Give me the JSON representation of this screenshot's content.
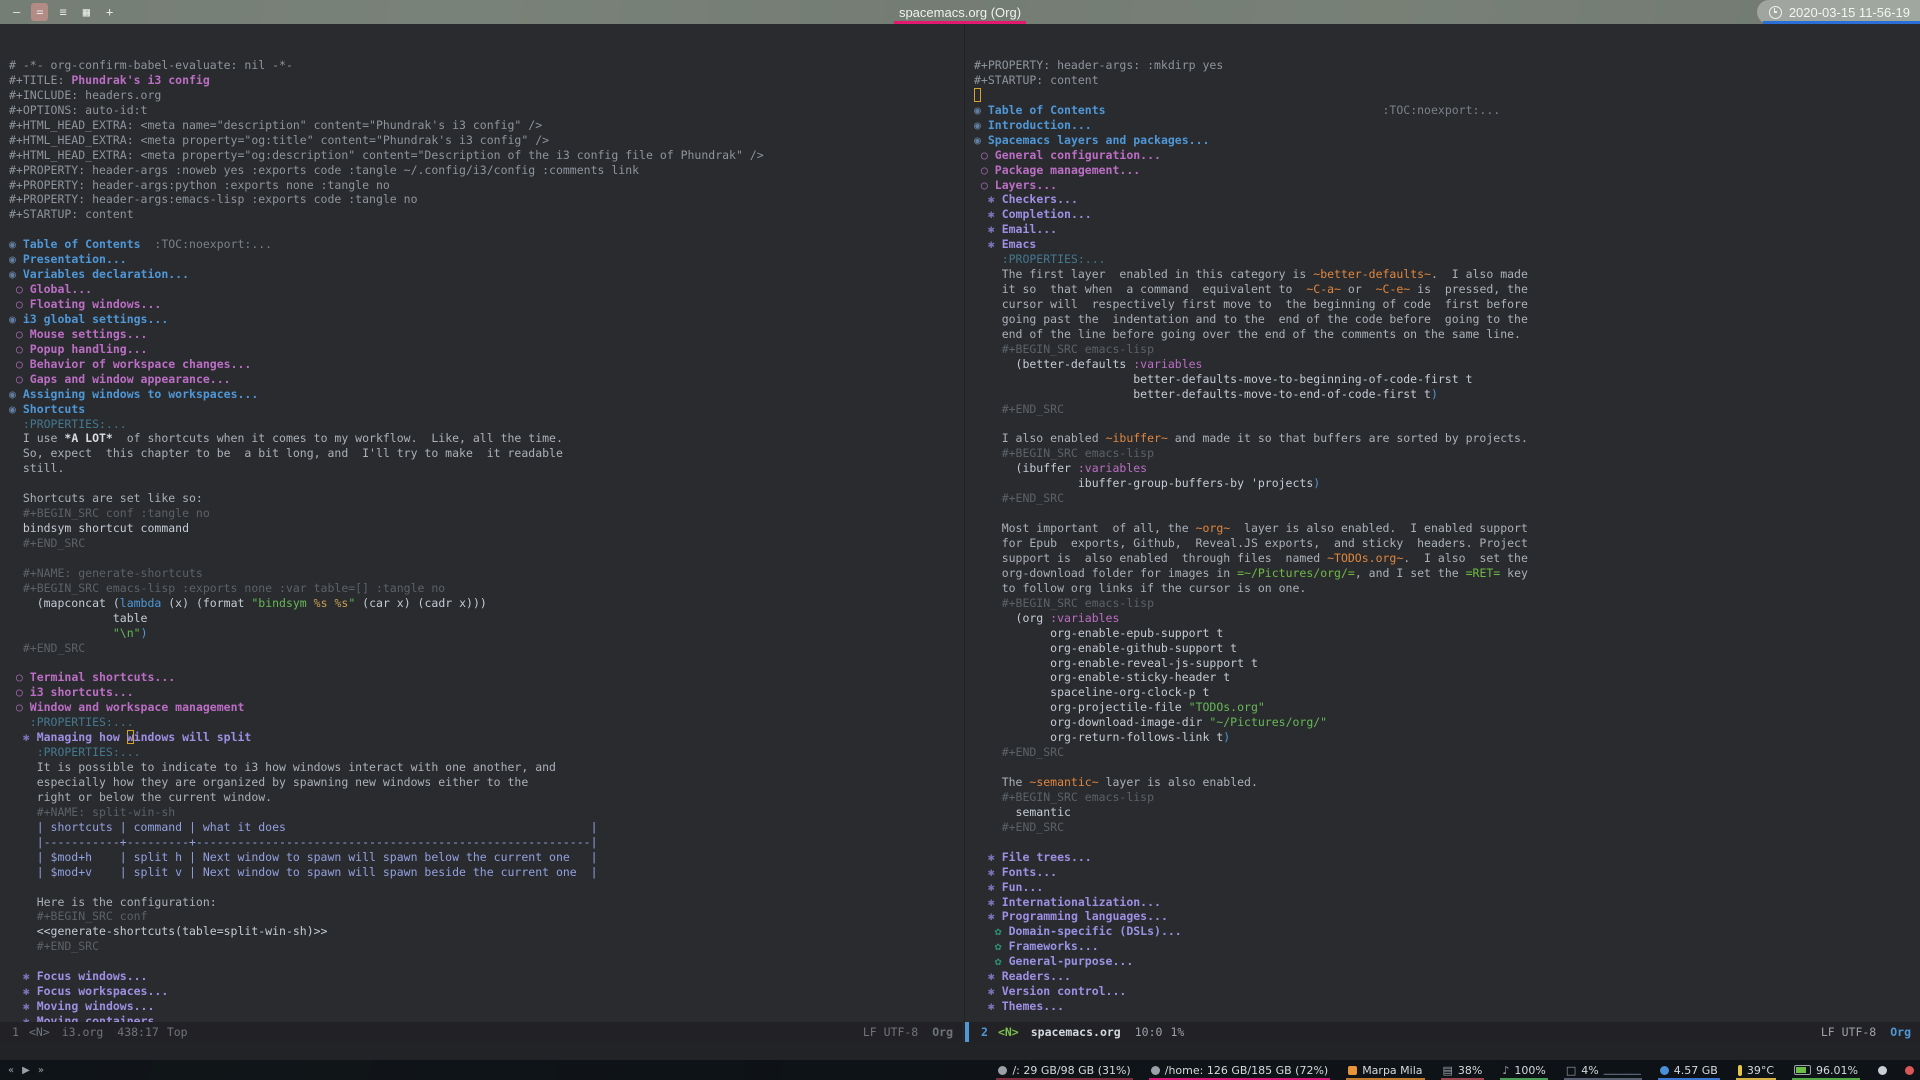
{
  "titlebar": {
    "title": "spacemacs.org (Org)",
    "clock": "2020-03-15 11-56-19",
    "accent_title_underline": "#e2196e",
    "accent_clock_underline": "#2a6fd6",
    "icons": [
      {
        "name": "layout-splith-icon",
        "glyph": "—",
        "active": false
      },
      {
        "name": "layout-stacking-icon",
        "glyph": "=",
        "active": true
      },
      {
        "name": "layout-tabbed-icon",
        "glyph": "≡",
        "active": false
      },
      {
        "name": "layout-grid-icon",
        "glyph": "▦",
        "active": false
      },
      {
        "name": "new-window-icon",
        "glyph": "+",
        "active": false
      }
    ]
  },
  "left_pane": {
    "lines": [
      [
        [
          "cm",
          "# -*- org-confirm-babel-evaluate: nil -*-"
        ]
      ],
      [
        [
          "cm",
          "#+TITLE: "
        ],
        [
          "title",
          "Phundrak's i3 config"
        ]
      ],
      [
        [
          "cm",
          "#+INCLUDE: headers.org"
        ]
      ],
      [
        [
          "cm",
          "#+OPTIONS: auto-id:t"
        ]
      ],
      [
        [
          "cm",
          "#+HTML_HEAD_EXTRA: <meta name=\"description\" content=\"Phundrak's i3 config\" />"
        ]
      ],
      [
        [
          "cm",
          "#+HTML_HEAD_EXTRA: <meta property=\"og:title\" content=\"Phundrak's i3 config\" />"
        ]
      ],
      [
        [
          "cm",
          "#+HTML_HEAD_EXTRA: <meta property=\"og:description\" content=\"Description of the i3 config file of Phundrak\" />"
        ]
      ],
      [
        [
          "cm",
          "#+PROPERTY: header-args :noweb yes :exports code :tangle ~/.config/i3/config :comments link"
        ]
      ],
      [
        [
          "cm",
          "#+PROPERTY: header-args:python :exports none :tangle no"
        ]
      ],
      [
        [
          "cm",
          "#+PROPERTY: header-args:emacs-lisp :exports code :tangle no"
        ]
      ],
      [
        [
          "cm",
          "#+STARTUP: content"
        ]
      ],
      [],
      [
        [
          "b1",
          "◉ "
        ],
        [
          "h1",
          "Table of Contents"
        ],
        [
          "tag",
          "  :TOC:noexport:..."
        ]
      ],
      [
        [
          "b1",
          "◉ "
        ],
        [
          "h1",
          "Presentation..."
        ]
      ],
      [
        [
          "b1",
          "◉ "
        ],
        [
          "h1",
          "Variables declaration..."
        ]
      ],
      [
        [
          "b2",
          " ○ "
        ],
        [
          "h2",
          "Global..."
        ]
      ],
      [
        [
          "b2",
          " ○ "
        ],
        [
          "h2",
          "Floating windows..."
        ]
      ],
      [
        [
          "b1",
          "◉ "
        ],
        [
          "h1",
          "i3 global settings..."
        ]
      ],
      [
        [
          "b2",
          " ○ "
        ],
        [
          "h2",
          "Mouse settings..."
        ]
      ],
      [
        [
          "b2",
          " ○ "
        ],
        [
          "h2",
          "Popup handling..."
        ]
      ],
      [
        [
          "b2",
          " ○ "
        ],
        [
          "h2",
          "Behavior of workspace changes..."
        ]
      ],
      [
        [
          "b2",
          " ○ "
        ],
        [
          "h2",
          "Gaps and window appearance..."
        ]
      ],
      [
        [
          "b1",
          "◉ "
        ],
        [
          "h1",
          "Assigning windows to workspaces..."
        ]
      ],
      [
        [
          "b1",
          "◉ "
        ],
        [
          "h1",
          "Shortcuts"
        ]
      ],
      [
        [
          "drawer",
          "  :PROPERTIES:..."
        ]
      ],
      [
        [
          "body",
          "  I use "
        ],
        [
          "bold",
          "*A LOT*"
        ],
        [
          "body",
          "  of shortcuts when it comes to my workflow.  Like, all the time."
        ]
      ],
      [
        [
          "body",
          "  So, expect  this chapter to be  a bit long, and  I'll try to make  it readable"
        ]
      ],
      [
        [
          "body",
          "  still."
        ]
      ],
      [],
      [
        [
          "body",
          "  Shortcuts are set like so:"
        ]
      ],
      [
        [
          "src",
          "  #+BEGIN_SRC conf :tangle no"
        ]
      ],
      [
        [
          "code",
          "  bindsym shortcut command"
        ]
      ],
      [
        [
          "src",
          "  #+END_SRC"
        ]
      ],
      [],
      [
        [
          "src",
          "  #+NAME: generate-shortcuts"
        ]
      ],
      [
        [
          "src",
          "  #+BEGIN_SRC emacs-lisp :exports none :var table=[] :tangle no"
        ]
      ],
      [
        [
          "code",
          "    (mapconcat ("
        ],
        [
          "kw",
          "lambda"
        ],
        [
          "code",
          " (x) (format "
        ],
        [
          "str",
          "\"bindsym "
        ],
        [
          "fmt",
          "%s"
        ],
        [
          "str",
          " "
        ],
        [
          "fmt",
          "%s"
        ],
        [
          "str",
          "\""
        ],
        [
          "code",
          " (car x) (cadr x)))"
        ]
      ],
      [
        [
          "code",
          "               table"
        ]
      ],
      [
        [
          "code",
          "               "
        ],
        [
          "str",
          "\"\\n\""
        ],
        [
          "pb",
          ")"
        ]
      ],
      [
        [
          "src",
          "  #+END_SRC"
        ]
      ],
      [],
      [
        [
          "b2",
          " ○ "
        ],
        [
          "h2",
          "Terminal shortcuts..."
        ]
      ],
      [
        [
          "b2",
          " ○ "
        ],
        [
          "h2",
          "i3 shortcuts..."
        ]
      ],
      [
        [
          "b2",
          " ○ "
        ],
        [
          "h2",
          "Window and workspace management"
        ]
      ],
      [
        [
          "drawer",
          "   :PROPERTIES:..."
        ]
      ],
      [
        [
          "b3",
          "  ✱ "
        ],
        [
          "h3",
          "Managing how "
        ],
        [
          "h3 cur",
          "w"
        ],
        [
          "h3",
          "indows will split"
        ]
      ],
      [
        [
          "drawer",
          "    :PROPERTIES:..."
        ]
      ],
      [
        [
          "body",
          "    It is possible to indicate to i3 how windows interact with one another, and"
        ]
      ],
      [
        [
          "body",
          "    especially how they are organized by spawning new windows either to the"
        ]
      ],
      [
        [
          "body",
          "    right or below the current window."
        ]
      ],
      [
        [
          "src",
          "    #+NAME: split-win-sh"
        ]
      ],
      [
        [
          "tbl",
          "    | shortcuts | command | what it does                                            |"
        ]
      ],
      [
        [
          "tbl",
          "    |-----------+---------+---------------------------------------------------------|"
        ]
      ],
      [
        [
          "tbl",
          "    | $mod+h    | split h | Next window to spawn will spawn below the current one   |"
        ]
      ],
      [
        [
          "tbl",
          "    | $mod+v    | split v | Next window to spawn will spawn beside the current one  |"
        ]
      ],
      [],
      [
        [
          "body",
          "    Here is the configuration:"
        ]
      ],
      [
        [
          "src",
          "    #+BEGIN_SRC conf"
        ]
      ],
      [
        [
          "code",
          "    <<generate-shortcuts(table=split-win-sh)>>"
        ]
      ],
      [
        [
          "src",
          "    #+END_SRC"
        ]
      ],
      [],
      [
        [
          "b3",
          "  ✱ "
        ],
        [
          "h3",
          "Focus windows..."
        ]
      ],
      [
        [
          "b3",
          "  ✱ "
        ],
        [
          "h3",
          "Focus workspaces..."
        ]
      ],
      [
        [
          "b3",
          "  ✱ "
        ],
        [
          "h3",
          "Moving windows..."
        ]
      ],
      [
        [
          "b3",
          "  ✱ "
        ],
        [
          "h3",
          "Moving containers..."
        ]
      ]
    ]
  },
  "right_pane": {
    "lines": [
      [
        [
          "cm",
          "#+PROPERTY: header-args: :mkdirp yes"
        ]
      ],
      [
        [
          "cm",
          "#+STARTUP: content"
        ]
      ],
      [
        [
          "cur",
          " "
        ]
      ],
      [
        [
          "b1",
          "◉ "
        ],
        [
          "h1",
          "Table of Contents"
        ],
        [
          "tag",
          "                                        :TOC:noexport:..."
        ]
      ],
      [
        [
          "b1",
          "◉ "
        ],
        [
          "h1",
          "Introduction..."
        ]
      ],
      [
        [
          "b1",
          "◉ "
        ],
        [
          "h1",
          "Spacemacs layers and packages..."
        ]
      ],
      [
        [
          "b2",
          " ○ "
        ],
        [
          "h2",
          "General configuration..."
        ]
      ],
      [
        [
          "b2",
          " ○ "
        ],
        [
          "h2",
          "Package management..."
        ]
      ],
      [
        [
          "b2",
          " ○ "
        ],
        [
          "h2",
          "Layers..."
        ]
      ],
      [
        [
          "b3",
          "  ✱ "
        ],
        [
          "h3",
          "Checkers..."
        ]
      ],
      [
        [
          "b3",
          "  ✱ "
        ],
        [
          "h3",
          "Completion..."
        ]
      ],
      [
        [
          "b3",
          "  ✱ "
        ],
        [
          "h3",
          "Email..."
        ]
      ],
      [
        [
          "b3",
          "  ✱ "
        ],
        [
          "h3",
          "Emacs"
        ]
      ],
      [
        [
          "drawer",
          "    :PROPERTIES:..."
        ]
      ],
      [
        [
          "body",
          "    The first layer  enabled in this category is "
        ],
        [
          "ic",
          "~better-defaults~"
        ],
        [
          "body",
          ".  I also made"
        ]
      ],
      [
        [
          "body",
          "    it so  that when  a command  equivalent to  "
        ],
        [
          "ic",
          "~C-a~"
        ],
        [
          "body",
          " or  "
        ],
        [
          "ic",
          "~C-e~"
        ],
        [
          "body",
          " is  pressed, the"
        ]
      ],
      [
        [
          "body",
          "    cursor will  respectively first move to  the beginning of code  first before"
        ]
      ],
      [
        [
          "body",
          "    going past the  indentation and to the  end of the code before  going to the"
        ]
      ],
      [
        [
          "body",
          "    end of the line before going over the end of the comments on the same line."
        ]
      ],
      [
        [
          "src",
          "    #+BEGIN_SRC emacs-lisp"
        ]
      ],
      [
        [
          "code",
          "      (better-defaults "
        ],
        [
          "kwv",
          ":variables"
        ]
      ],
      [
        [
          "code",
          "                       better-defaults-move-to-beginning-of-code-first t"
        ]
      ],
      [
        [
          "code",
          "                       better-defaults-move-to-end-of-code-first t"
        ],
        [
          "pb",
          ")"
        ]
      ],
      [
        [
          "src",
          "    #+END_SRC"
        ]
      ],
      [],
      [
        [
          "body",
          "    I also enabled "
        ],
        [
          "ic",
          "~ibuffer~"
        ],
        [
          "body",
          " and made it so that buffers are sorted by projects."
        ]
      ],
      [
        [
          "src",
          "    #+BEGIN_SRC emacs-lisp"
        ]
      ],
      [
        [
          "code",
          "      (ibuffer "
        ],
        [
          "kwv",
          ":variables"
        ]
      ],
      [
        [
          "code",
          "               ibuffer-group-buffers-by 'projects"
        ],
        [
          "pb",
          ")"
        ]
      ],
      [
        [
          "src",
          "    #+END_SRC"
        ]
      ],
      [],
      [
        [
          "body",
          "    Most important  of all, the "
        ],
        [
          "ic",
          "~org~"
        ],
        [
          "body",
          "  layer is also enabled.  I enabled support"
        ]
      ],
      [
        [
          "body",
          "    for Epub  exports, Github,  Reveal.JS exports,  and sticky  headers. Project"
        ]
      ],
      [
        [
          "body",
          "    support is  also enabled  through files  named "
        ],
        [
          "ic",
          "~TODOs.org~"
        ],
        [
          "body",
          ".  I also  set the"
        ]
      ],
      [
        [
          "body",
          "    org-download folder for images in "
        ],
        [
          "verb",
          "=~/Pictures/org/="
        ],
        [
          "body",
          ", and I set the "
        ],
        [
          "verb",
          "=RET="
        ],
        [
          "body",
          " key"
        ]
      ],
      [
        [
          "body",
          "    to follow org links if the cursor is on one."
        ]
      ],
      [
        [
          "src",
          "    #+BEGIN_SRC emacs-lisp"
        ]
      ],
      [
        [
          "code",
          "      (org "
        ],
        [
          "kwv",
          ":variables"
        ]
      ],
      [
        [
          "code",
          "           org-enable-epub-support t"
        ]
      ],
      [
        [
          "code",
          "           org-enable-github-support t"
        ]
      ],
      [
        [
          "code",
          "           org-enable-reveal-js-support t"
        ]
      ],
      [
        [
          "code",
          "           org-enable-sticky-header t"
        ]
      ],
      [
        [
          "code",
          "           spaceline-org-clock-p t"
        ]
      ],
      [
        [
          "code",
          "           org-projectile-file "
        ],
        [
          "str",
          "\"TODOs.org\""
        ]
      ],
      [
        [
          "code",
          "           org-download-image-dir "
        ],
        [
          "str",
          "\"~/Pictures/org/\""
        ]
      ],
      [
        [
          "code",
          "           org-return-follows-link t"
        ],
        [
          "pb",
          ")"
        ]
      ],
      [
        [
          "src",
          "    #+END_SRC"
        ]
      ],
      [],
      [
        [
          "body",
          "    The "
        ],
        [
          "ic",
          "~semantic~"
        ],
        [
          "body",
          " layer is also enabled."
        ]
      ],
      [
        [
          "src",
          "    #+BEGIN_SRC emacs-lisp"
        ]
      ],
      [
        [
          "code",
          "      semantic"
        ]
      ],
      [
        [
          "src",
          "    #+END_SRC"
        ]
      ],
      [],
      [
        [
          "b3",
          "  ✱ "
        ],
        [
          "h3",
          "File trees..."
        ]
      ],
      [
        [
          "b3",
          "  ✱ "
        ],
        [
          "h3",
          "Fonts..."
        ]
      ],
      [
        [
          "b3",
          "  ✱ "
        ],
        [
          "h3",
          "Fun..."
        ]
      ],
      [
        [
          "b3",
          "  ✱ "
        ],
        [
          "h3",
          "Internationalization..."
        ]
      ],
      [
        [
          "b3",
          "  ✱ "
        ],
        [
          "h3",
          "Programming languages..."
        ]
      ],
      [
        [
          "b4",
          "   ✿ "
        ],
        [
          "h4",
          "Domain-specific (DSLs)..."
        ]
      ],
      [
        [
          "b4",
          "   ✿ "
        ],
        [
          "h4",
          "Frameworks..."
        ]
      ],
      [
        [
          "b4",
          "   ✿ "
        ],
        [
          "h4",
          "General-purpose..."
        ]
      ],
      [
        [
          "b3",
          "  ✱ "
        ],
        [
          "h3",
          "Readers..."
        ]
      ],
      [
        [
          "b3",
          "  ✱ "
        ],
        [
          "h3",
          "Version control..."
        ]
      ],
      [
        [
          "b3",
          "  ✱ "
        ],
        [
          "h3",
          "Themes..."
        ]
      ]
    ]
  },
  "left_modeline": {
    "win": "1",
    "state": "<N>",
    "buffer": "i3.org",
    "pos": "438:17",
    "scroll": "Top",
    "encoding": "LF UTF-8",
    "mode": "Org"
  },
  "right_modeline": {
    "win": "2",
    "state": "<N>",
    "buffer": "spacemacs.org",
    "pos": "10:0",
    "scroll": "1%",
    "encoding": "LF UTF-8",
    "mode": "Org"
  },
  "bottom_bar": {
    "player": [
      {
        "name": "media-previous-icon",
        "glyph": "«"
      },
      {
        "name": "media-play-icon",
        "glyph": "▶"
      },
      {
        "name": "media-next-icon",
        "glyph": "»"
      }
    ],
    "modules": [
      {
        "name": "disk-root",
        "icon": "dot",
        "icon_color": "#9aa1a8",
        "text": "/: 29 GB/98 GB (31%)",
        "underline": "#7d2d3f"
      },
      {
        "name": "disk-home",
        "icon": "dot",
        "icon_color": "#9aa1a8",
        "text": "/home: 126 GB/185 GB (72%)",
        "underline": "#d81b7a"
      },
      {
        "name": "music-track",
        "icon": "sq",
        "icon_color": "#e8953a",
        "text": "Marpa Mila",
        "underline": "#c07a30"
      },
      {
        "name": "memory",
        "icon": "glyph",
        "glyph": "▤",
        "icon_color": "#9aa1a8",
        "text": "38%",
        "underline": "#9c4650"
      },
      {
        "name": "volume",
        "icon": "glyph",
        "glyph": "♪",
        "icon_color": "#9aa1a8",
        "text": "100%",
        "underline": "#4a9e55"
      },
      {
        "name": "cpu",
        "icon": "glyph",
        "glyph": "□",
        "icon_color": "#9aa1a8",
        "text": "4%",
        "spark": "▁▁▁▁▁▁▁",
        "underline": "#566070"
      },
      {
        "name": "ram-used",
        "icon": "dot",
        "icon_color": "#4a90d9",
        "text": "4.57 GB",
        "underline": "#3a76d2"
      },
      {
        "name": "temperature",
        "icon": "bar",
        "icon_color": "#e8c545",
        "text": "39°C",
        "underline": "#d4b344"
      },
      {
        "name": "battery",
        "icon": "batt",
        "icon_color": "#6dbf47",
        "text": "96.01%",
        "underline": "#55a845"
      }
    ],
    "tray": [
      {
        "name": "tray-icon-1",
        "color": "#c9ced4"
      },
      {
        "name": "tray-icon-2",
        "color": "#d85858"
      }
    ]
  }
}
